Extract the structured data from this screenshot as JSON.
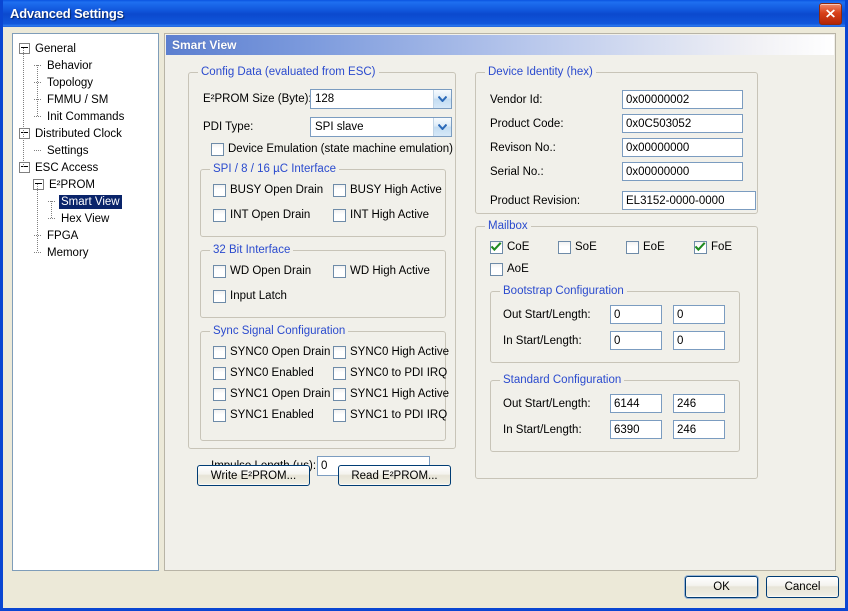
{
  "window": {
    "title": "Advanced Settings",
    "close_icon": "close-icon"
  },
  "sidebar": {
    "items": [
      {
        "label": "General",
        "depth": 0,
        "toggle": "minus"
      },
      {
        "label": "Behavior",
        "depth": 1,
        "toggle": "none"
      },
      {
        "label": "Topology",
        "depth": 1,
        "toggle": "none"
      },
      {
        "label": "FMMU / SM",
        "depth": 1,
        "toggle": "none"
      },
      {
        "label": "Init Commands",
        "depth": 1,
        "toggle": "none"
      },
      {
        "label": "Distributed Clock",
        "depth": 0,
        "toggle": "minus"
      },
      {
        "label": "Settings",
        "depth": 1,
        "toggle": "none"
      },
      {
        "label": "ESC Access",
        "depth": 0,
        "toggle": "minus"
      },
      {
        "label": "E²PROM",
        "depth": 1,
        "toggle": "minus"
      },
      {
        "label": "Smart View",
        "depth": 2,
        "toggle": "none",
        "selected": true
      },
      {
        "label": "Hex View",
        "depth": 2,
        "toggle": "none"
      },
      {
        "label": "FPGA",
        "depth": 1,
        "toggle": "none"
      },
      {
        "label": "Memory",
        "depth": 1,
        "toggle": "none"
      }
    ]
  },
  "view": {
    "header_title": "Smart View"
  },
  "config_data": {
    "group_title": "Config Data (evaluated from ESC)",
    "eeprom_size_label": "E²PROM Size (Byte):",
    "eeprom_size_value": "128",
    "pdi_type_label": "PDI Type:",
    "pdi_type_value": "SPI slave",
    "device_emulation_label": "Device Emulation (state machine emulation)",
    "device_emulation_checked": false
  },
  "spi_interface": {
    "group_title": "SPI / 8 / 16 µC Interface",
    "checkboxes": [
      {
        "label": "BUSY Open Drain",
        "checked": false
      },
      {
        "label": "BUSY High Active",
        "checked": false
      },
      {
        "label": "INT Open Drain",
        "checked": false
      },
      {
        "label": "INT High Active",
        "checked": false
      }
    ]
  },
  "bit32_interface": {
    "group_title": "32 Bit Interface",
    "checkboxes": [
      {
        "label": "WD Open Drain",
        "checked": false
      },
      {
        "label": "WD High Active",
        "checked": false
      },
      {
        "label": "Input Latch",
        "checked": false
      }
    ]
  },
  "sync_signal": {
    "group_title": "Sync Signal Configuration",
    "checkboxes": [
      {
        "label": "SYNC0 Open Drain",
        "checked": false
      },
      {
        "label": "SYNC0 High Active",
        "checked": false
      },
      {
        "label": "SYNC0 Enabled",
        "checked": false
      },
      {
        "label": "SYNC0 to PDI IRQ",
        "checked": false
      },
      {
        "label": "SYNC1 Open Drain",
        "checked": false
      },
      {
        "label": "SYNC1 High Active",
        "checked": false
      },
      {
        "label": "SYNC1 Enabled",
        "checked": false
      },
      {
        "label": "SYNC1 to PDI IRQ",
        "checked": false
      }
    ],
    "impulse_length_label": "Impulse Length (µs):",
    "impulse_length_value": "0"
  },
  "eeprom_buttons": {
    "write_label": "Write E²PROM...",
    "read_label": "Read E²PROM..."
  },
  "device_identity": {
    "group_title": "Device Identity (hex)",
    "fields": [
      {
        "label": "Vendor Id:",
        "value": "0x00000002"
      },
      {
        "label": "Product Code:",
        "value": "0x0C503052"
      },
      {
        "label": "Revison No.:",
        "value": "0x00000000"
      },
      {
        "label": "Serial No.:",
        "value": "0x00000000"
      }
    ],
    "product_revision_label": "Product Revision:",
    "product_revision_value": "EL3152-0000-0000"
  },
  "mailbox": {
    "group_title": "Mailbox",
    "protocols": [
      {
        "label": "CoE",
        "checked": true
      },
      {
        "label": "SoE",
        "checked": false
      },
      {
        "label": "EoE",
        "checked": false
      },
      {
        "label": "FoE",
        "checked": true
      },
      {
        "label": "AoE",
        "checked": false
      }
    ],
    "bootstrap": {
      "group_title": "Bootstrap Configuration",
      "out_label": "Out Start/Length:",
      "out_start": "0",
      "out_length": "0",
      "in_label": "In Start/Length:",
      "in_start": "0",
      "in_length": "0"
    },
    "standard": {
      "group_title": "Standard Configuration",
      "out_label": "Out Start/Length:",
      "out_start": "6144",
      "out_length": "246",
      "in_label": "In Start/Length:",
      "in_start": "6390",
      "in_length": "246"
    }
  },
  "footer": {
    "ok_label": "OK",
    "cancel_label": "Cancel"
  },
  "colors": {
    "titlebar_blue": "#1157DC",
    "group_title_blue": "#2B4BCE",
    "selection_blue": "#0A246A",
    "check_green": "#1F8A1F",
    "dialog_bg": "#ECE9D8",
    "close_red": "#D8401A"
  }
}
